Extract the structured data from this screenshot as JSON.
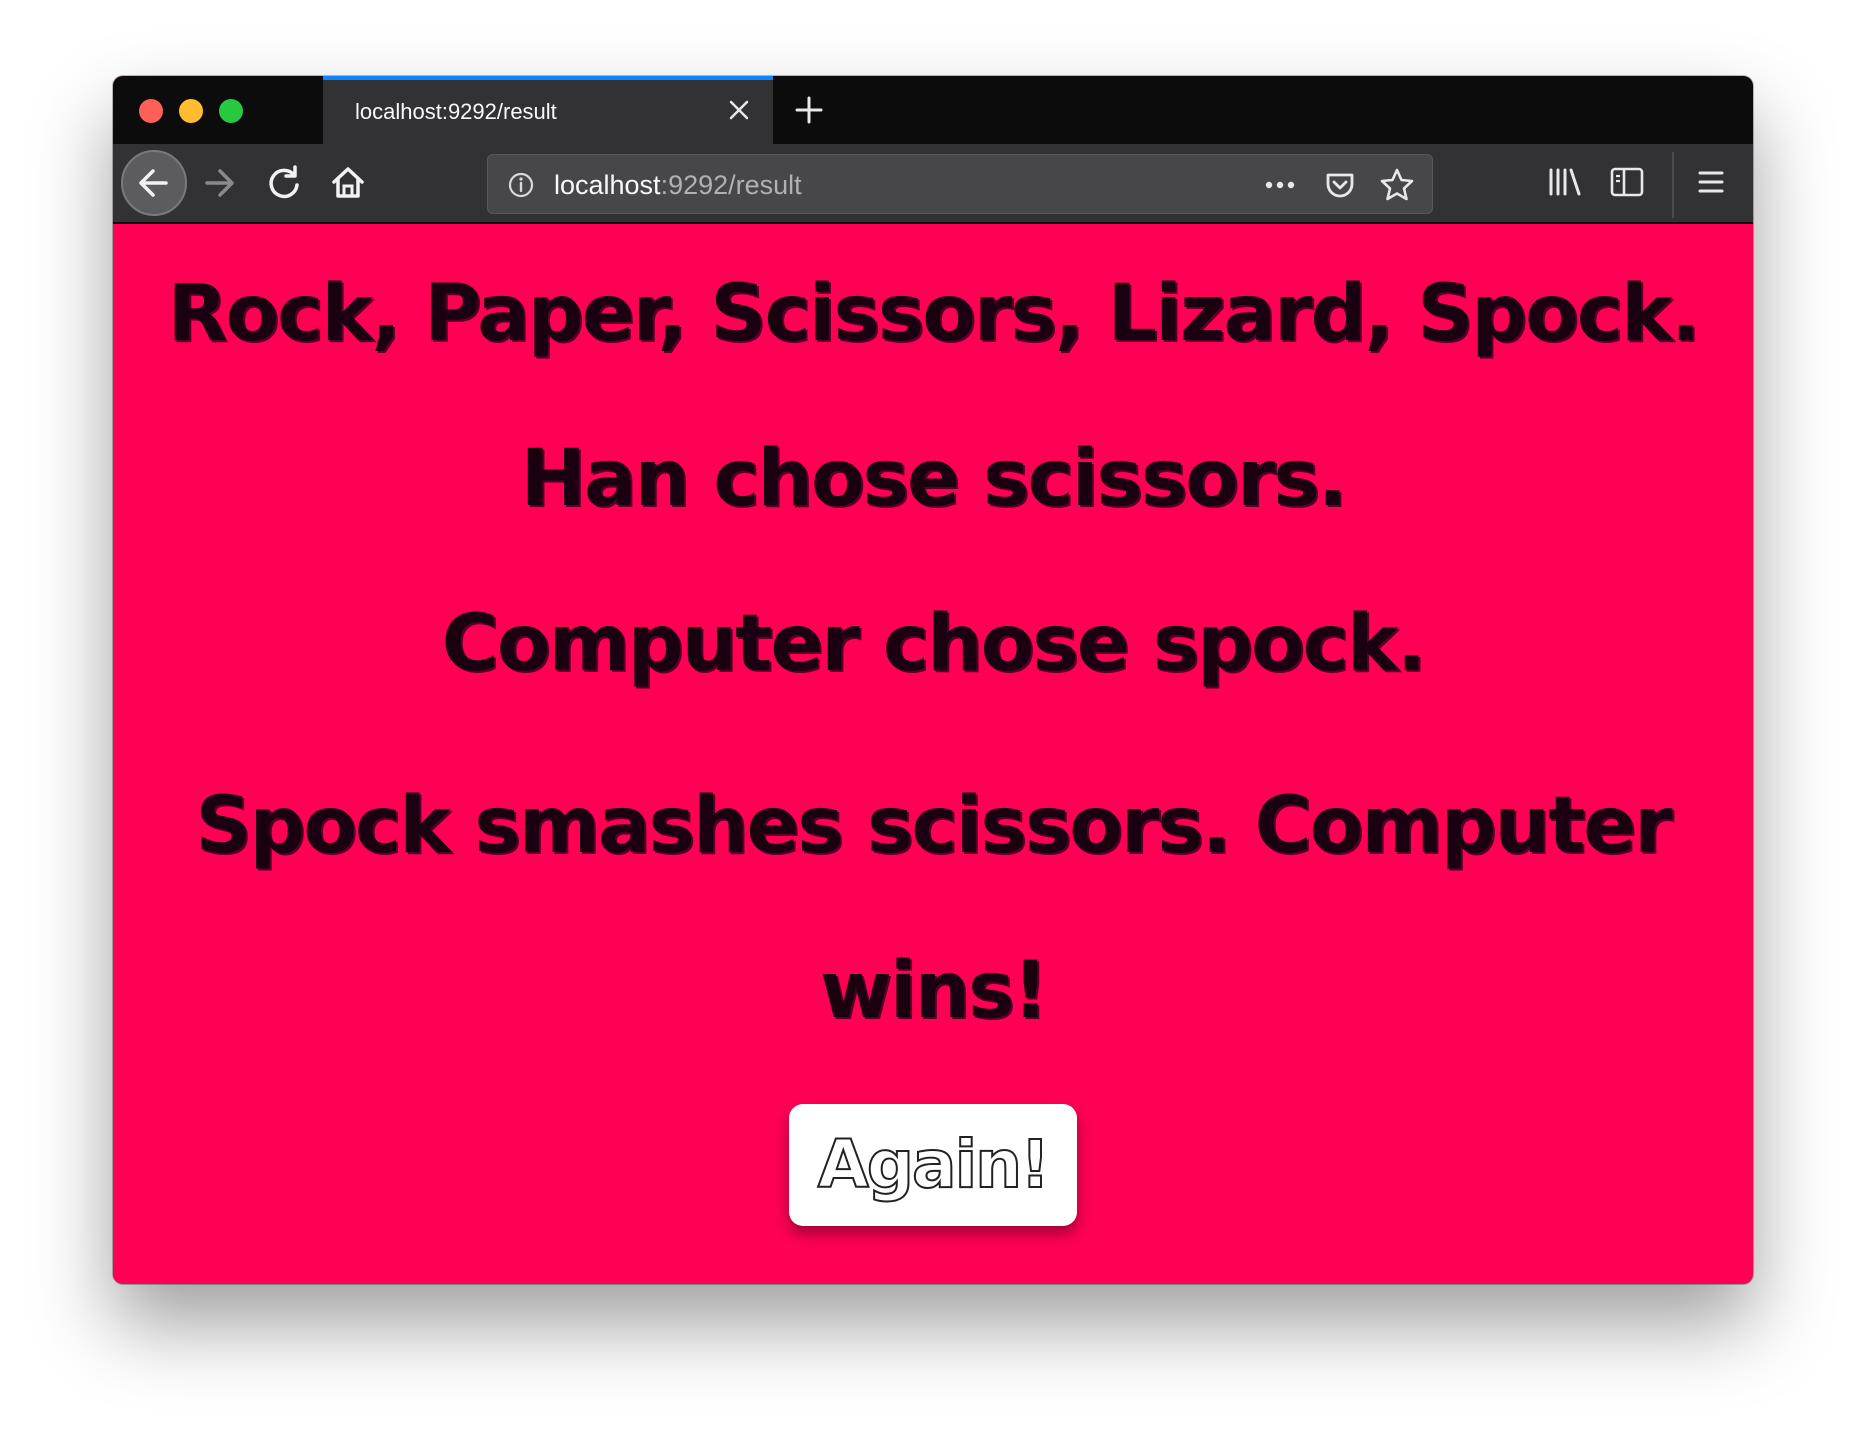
{
  "browser": {
    "tab": {
      "title": "localhost:9292/result"
    },
    "url": {
      "host": "localhost",
      "rest": ":9292/result"
    },
    "colors": {
      "tab_accent": "#0a84ff",
      "toolbar": "#323234",
      "tabstrip": "#0c0c0d"
    }
  },
  "page": {
    "title": "Rock, Paper, Scissors, Lizard, Spock.",
    "player_choice": "Han chose scissors.",
    "computer_choice": "Computer chose spock.",
    "result": "Spock smashes scissors. Computer wins!",
    "again_label": "Again!",
    "background_color": "#ff0055"
  },
  "icons": {
    "back": "arrow-left-icon",
    "forward": "arrow-right-icon",
    "reload": "reload-icon",
    "home": "home-icon",
    "info": "info-icon",
    "page_actions": "more-icon",
    "pocket": "pocket-icon",
    "bookmark": "star-icon",
    "library": "library-icon",
    "sidebar": "sidebar-icon",
    "menu": "hamburger-menu-icon",
    "close_tab": "close-icon",
    "new_tab": "plus-icon"
  }
}
